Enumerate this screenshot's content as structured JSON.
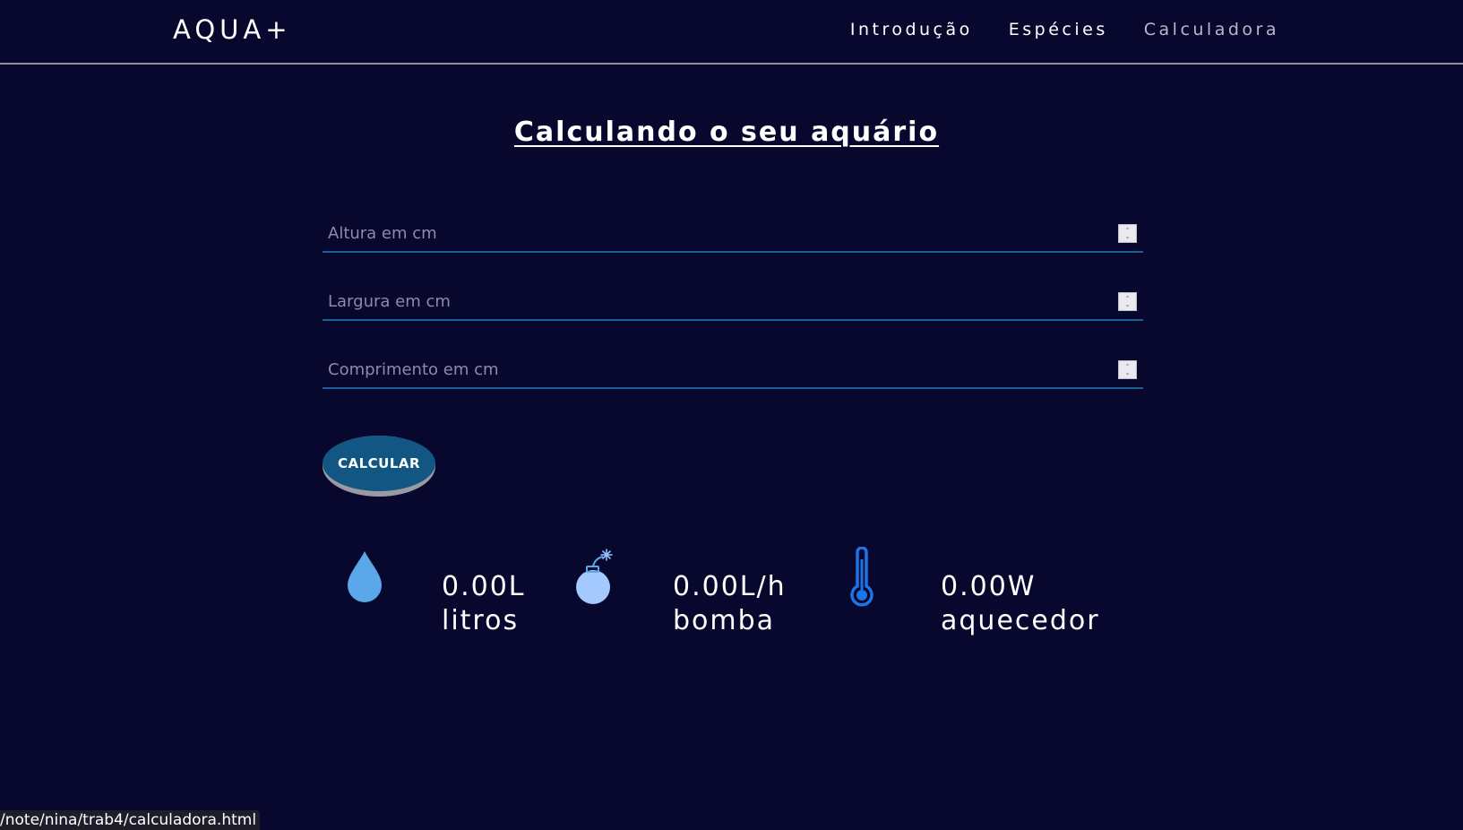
{
  "nav": {
    "brand": "AQUA+",
    "links": [
      "Introdução",
      "Espécies",
      "Calculadora"
    ]
  },
  "main": {
    "title": "Calculando o seu aquário",
    "fields": [
      {
        "placeholder": "Altura em cm",
        "value": ""
      },
      {
        "placeholder": "Largura em cm",
        "value": ""
      },
      {
        "placeholder": "Comprimento em cm",
        "value": ""
      }
    ],
    "button_label": "CALCULAR",
    "results": [
      {
        "icon": "water-drop-icon",
        "value": "0.00L",
        "label": "litros"
      },
      {
        "icon": "bomb-icon",
        "value": "0.00L/h",
        "label": "bomba"
      },
      {
        "icon": "thermometer-icon",
        "value": "0.00W",
        "label": "aquecedor"
      }
    ]
  },
  "status_bar": {
    "url": "/note/nina/trab4/calculadora.html"
  },
  "colors": {
    "background": "#08082e",
    "accent_blue": "#125783",
    "field_underline": "#1b5f98",
    "icon_light_blue": "#5aa8ea",
    "icon_blue": "#1d74e6"
  }
}
